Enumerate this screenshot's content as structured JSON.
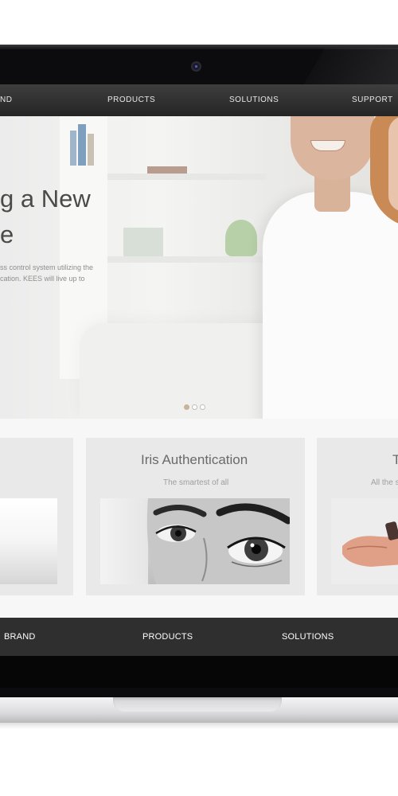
{
  "nav_top": {
    "items": [
      "ND",
      "PRODUCTS",
      "SOLUTIONS",
      "SUPPORT"
    ]
  },
  "hero": {
    "title_line1": "g a New",
    "title_line2": "e",
    "text_line1": "ss control system utilizing the",
    "text_line2": "cation. KEES will live up to",
    "slides": 3,
    "active_slide": 1
  },
  "cards": [
    {
      "title": "",
      "subtitle": ""
    },
    {
      "title": "Iris Authentication",
      "subtitle": "The smartest of all"
    },
    {
      "title": "T",
      "subtitle": "All the s"
    }
  ],
  "nav_bottom": {
    "items": [
      "BRAND",
      "PRODUCTS",
      "SOLUTIONS"
    ]
  },
  "colors": {
    "nav_bg": "#2f2f2f",
    "accent_dot": "#c8b49a",
    "card_bg": "#e9e9e9"
  },
  "icons": [
    "camera-icon",
    "slider-dot-icon"
  ]
}
